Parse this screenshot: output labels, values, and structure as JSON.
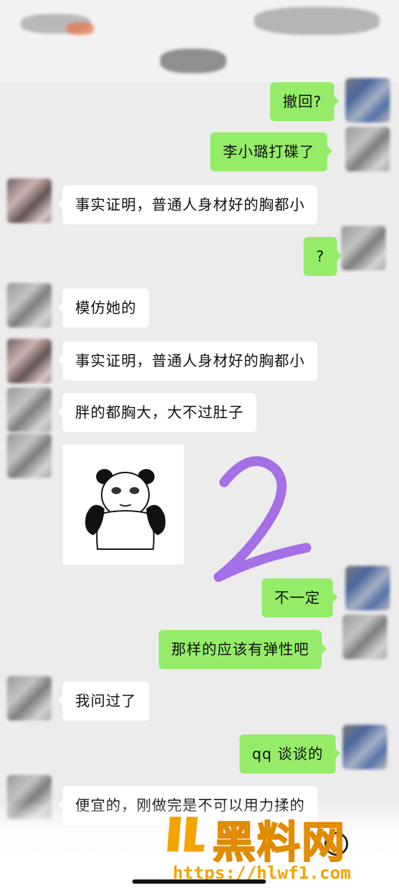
{
  "messages": [
    {
      "side": "right",
      "text": "撤回?"
    },
    {
      "side": "right",
      "text": "李小璐打碟了"
    },
    {
      "side": "left",
      "text": "事实证明，普通人身材好的胸都小"
    },
    {
      "side": "right",
      "text": "?"
    },
    {
      "side": "left",
      "text": "模仿她的"
    },
    {
      "side": "left",
      "text": "事实证明，普通人身材好的胸都小"
    },
    {
      "side": "left",
      "text": "胖的都胸大，大不过肚子"
    },
    {
      "side": "right",
      "text": "不一定"
    },
    {
      "side": "right",
      "text": "那样的应该有弹性吧"
    },
    {
      "side": "left",
      "text": "我问过了"
    },
    {
      "side": "right",
      "text": "qq 谈谈的"
    },
    {
      "side": "left",
      "text": "便宜的，刚做完是不可以用力揉的"
    }
  ],
  "watermark": {
    "brand": "黑料网",
    "url": "https://hlwf1.com"
  },
  "colors": {
    "background": "#ececec",
    "bubble_sent": "#95ec69",
    "bubble_received": "#ffffff",
    "annotation": "#9b5de5",
    "watermark": "#f5a300"
  },
  "icons": {
    "sticker": "panda-meme-sticker",
    "logo": "hl-logo-icon",
    "emoji": "emoji-icon"
  }
}
